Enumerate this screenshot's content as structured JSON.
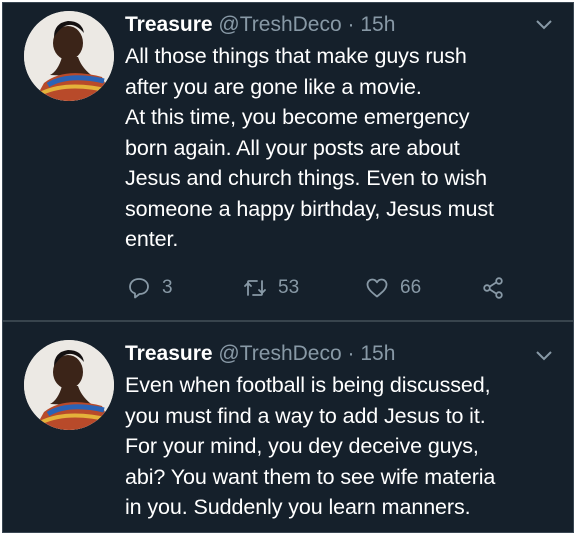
{
  "tweets": [
    {
      "name": "Treasure",
      "handle": "@TreshDeco",
      "separator": "·",
      "time": "15h",
      "text": "All those things that make guys rush\nafter you are gone like a movie.\nAt this time, you become emergency\nborn again. All your posts are about\nJesus and church things. Even to wish\nsomeone a happy birthday, Jesus must\nenter.",
      "replies": "3",
      "retweets": "53",
      "likes": "66"
    },
    {
      "name": "Treasure",
      "handle": "@TreshDeco",
      "separator": "·",
      "time": "15h",
      "text": "Even when football is being discussed,\nyou must find a way to add Jesus to it.\nFor your mind, you dey deceive guys,\nabi? You want them to see wife materia\nin you. Suddenly you learn manners."
    }
  ],
  "icons": {
    "caret": "chevron-down-icon",
    "reply": "reply-icon",
    "retweet": "retweet-icon",
    "like": "heart-icon",
    "share": "share-icon"
  },
  "colors": {
    "background": "#15202b",
    "divider": "#38444d",
    "primary_text": "#ffffff",
    "secondary_text": "#8899a6"
  }
}
